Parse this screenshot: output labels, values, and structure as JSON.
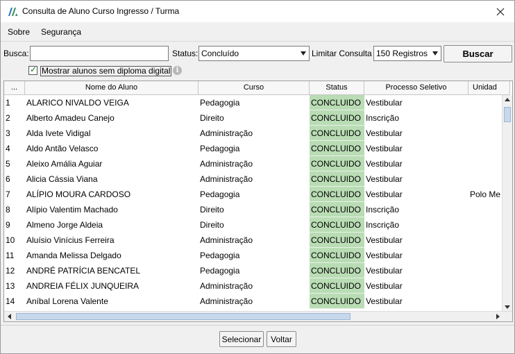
{
  "window": {
    "title": "Consulta de Aluno Curso Ingresso / Turma"
  },
  "menu": {
    "items": [
      "Sobre",
      "Segurança"
    ]
  },
  "filters": {
    "search_label": "Busca:",
    "search_value": "",
    "status_label": "Status:",
    "status_value": "Concluído",
    "limit_label": "Limitar Consulta",
    "limit_value": "150 Registros",
    "search_button": "Buscar",
    "checkbox_label": "Mostrar alunos sem diploma digital",
    "checkbox_checked": true
  },
  "table": {
    "headers": [
      "...",
      "Nome do Aluno",
      "Curso",
      "Status",
      "Processo Seletivo",
      "Unidad"
    ],
    "rows": [
      [
        "1",
        "ALARICO NIVALDO VEIGA",
        "Pedagogia",
        "CONCLUIDO",
        "Vestibular",
        ""
      ],
      [
        "2",
        "Alberto Amadeu Canejo",
        "Direito",
        "CONCLUIDO",
        "Inscrição",
        ""
      ],
      [
        "3",
        "Alda Ivete Vidigal",
        "Administração",
        "CONCLUIDO",
        "Vestibular",
        ""
      ],
      [
        "4",
        "Aldo Antão Velasco",
        "Pedagogia",
        "CONCLUIDO",
        "Vestibular",
        ""
      ],
      [
        "5",
        "Aleixo Amália Aguiar",
        "Administração",
        "CONCLUIDO",
        "Vestibular",
        ""
      ],
      [
        "6",
        "Alicia Cássia Viana",
        "Administração",
        "CONCLUIDO",
        "Vestibular",
        ""
      ],
      [
        "7",
        "ALÍPIO MOURA CARDOSO",
        "Pedagogia",
        "CONCLUIDO",
        "Vestibular",
        "Polo Me"
      ],
      [
        "8",
        "Alípio Valentim Machado",
        "Direito",
        "CONCLUIDO",
        "Inscrição",
        ""
      ],
      [
        "9",
        "Almeno Jorge Aldeia",
        "Direito",
        "CONCLUIDO",
        "Inscrição",
        ""
      ],
      [
        "10",
        "Aluísio Vinícius Ferreira",
        "Administração",
        "CONCLUIDO",
        "Vestibular",
        ""
      ],
      [
        "11",
        "Amanda Melissa Delgado",
        "Pedagogia",
        "CONCLUIDO",
        "Vestibular",
        ""
      ],
      [
        "12",
        "ANDRÉ PATRÍCIA BENCATEL",
        "Pedagogia",
        "CONCLUIDO",
        "Vestibular",
        ""
      ],
      [
        "13",
        "ANDREIA FÉLIX JUNQUEIRA",
        "Administração",
        "CONCLUIDO",
        "Vestibular",
        ""
      ],
      [
        "14",
        "Aníbal Lorena Valente",
        "Administração",
        "CONCLUIDO",
        "Vestibular",
        ""
      ]
    ]
  },
  "footer": {
    "select_button": "Selecionar",
    "back_button": "Voltar"
  },
  "colors": {
    "status_bg": "#b9dcb4",
    "app_icon": "#2e8b57"
  }
}
